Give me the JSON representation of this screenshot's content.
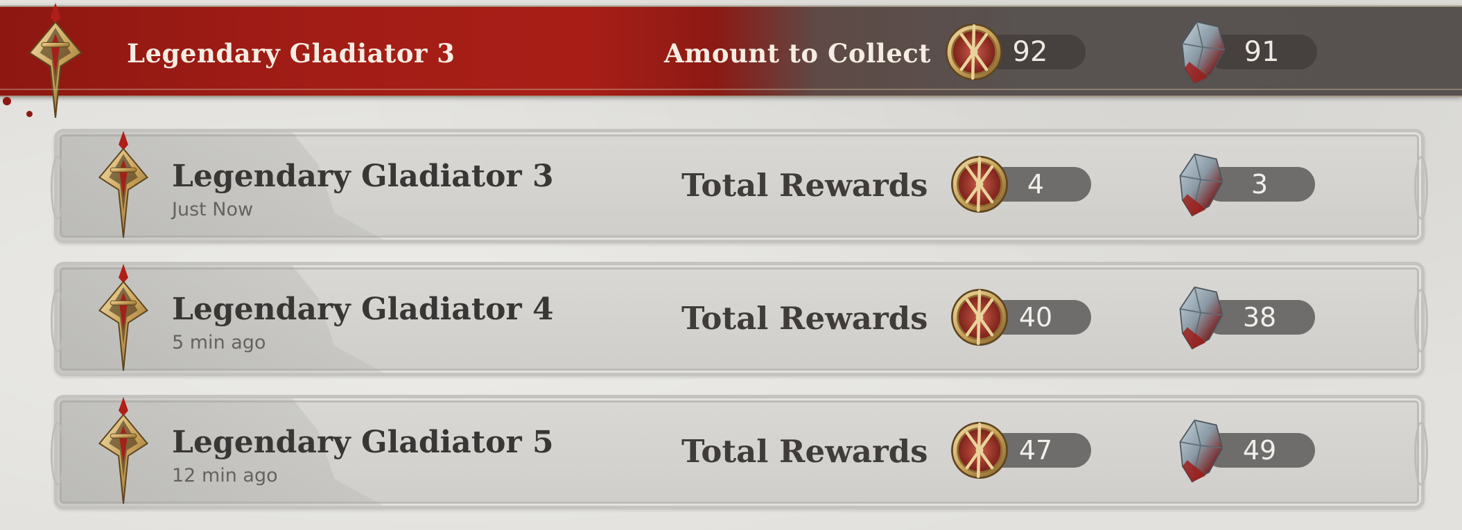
{
  "header": {
    "title": "Legendary Gladiator 3",
    "collect_label": "Amount to Collect",
    "medal_amount": "92",
    "shard_amount": "91"
  },
  "rows": [
    {
      "title": "Legendary Gladiator 3",
      "time": "Just Now",
      "total_label": "Total Rewards",
      "medal_amount": "4",
      "shard_amount": "3"
    },
    {
      "title": "Legendary Gladiator 4",
      "time": "5 min ago",
      "total_label": "Total Rewards",
      "medal_amount": "40",
      "shard_amount": "38"
    },
    {
      "title": "Legendary Gladiator 5",
      "time": "12 min ago",
      "total_label": "Total Rewards",
      "medal_amount": "47",
      "shard_amount": "49"
    }
  ],
  "icons": {
    "emblem": "gladiator-sword-emblem-icon",
    "medal": "gold-medal-coin-icon",
    "shard": "blood-crystal-shard-icon"
  },
  "colors": {
    "header_red": "#a21d16",
    "header_gray": "#57514f",
    "row_bg": "#d6d5d1",
    "pill_dark": "#46403f",
    "pill_row": "#6f6d6c"
  }
}
